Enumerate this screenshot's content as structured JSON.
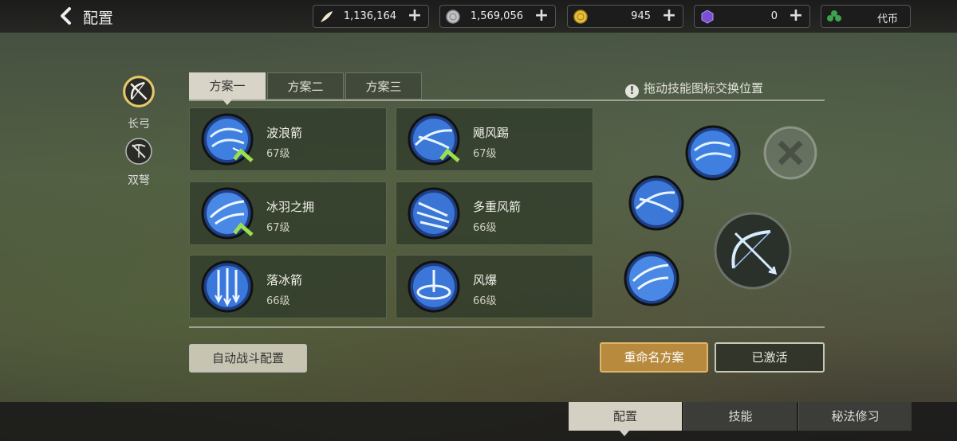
{
  "header": {
    "title": "配置",
    "resources": [
      {
        "icon": "feather-icon",
        "value": "1,136,164"
      },
      {
        "icon": "silver-coin-icon",
        "value": "1,569,056"
      },
      {
        "icon": "gold-coin-icon",
        "value": "945"
      },
      {
        "icon": "purple-gem-icon",
        "value": "0"
      }
    ],
    "currency_label": "代币"
  },
  "weapons": [
    {
      "label": "长弓",
      "selected": true
    },
    {
      "label": "双弩",
      "selected": false
    }
  ],
  "tabs": [
    "方案一",
    "方案二",
    "方案三"
  ],
  "hint": "拖动技能图标交换位置",
  "skills": [
    {
      "name": "波浪箭",
      "level": "67级",
      "equipped": true
    },
    {
      "name": "飓风踢",
      "level": "67级",
      "equipped": true
    },
    {
      "name": "冰羽之拥",
      "level": "67级",
      "equipped": true
    },
    {
      "name": "多重风箭",
      "level": "66级",
      "equipped": false
    },
    {
      "name": "落冰箭",
      "level": "66级",
      "equipped": false
    },
    {
      "name": "风爆",
      "level": "66级",
      "equipped": false
    }
  ],
  "buttons": {
    "auto_battle": "自动战斗配置",
    "rename": "重命名方案",
    "activated": "已激活"
  },
  "bottom_tabs": [
    "配置",
    "技能",
    "秘法修习"
  ],
  "colors": {
    "accent_gold": "#b88a3d",
    "skill_blue": "#2f6fd0",
    "check_green": "#8bd44a"
  }
}
